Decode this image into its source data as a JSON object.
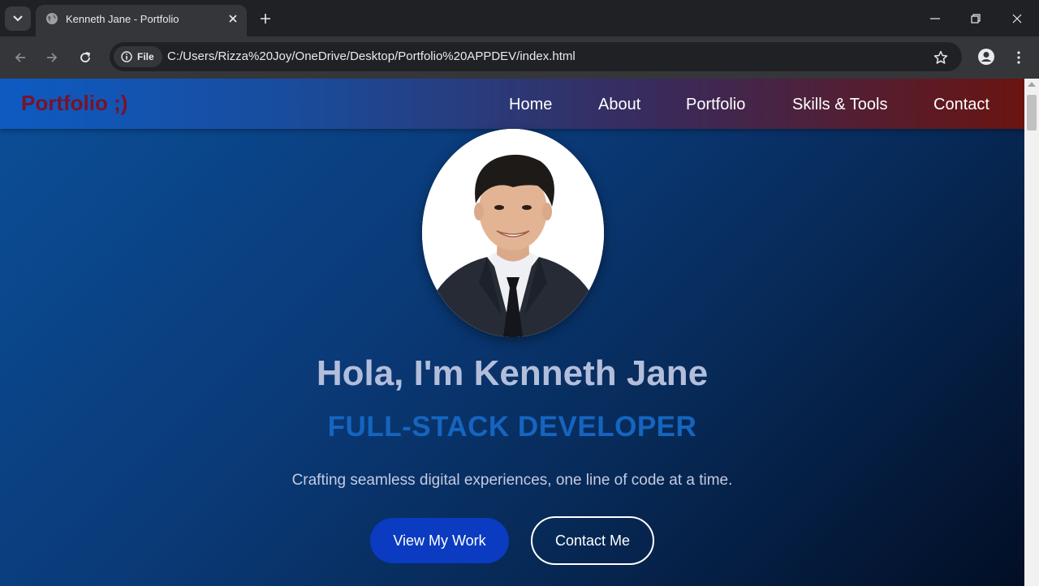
{
  "browser": {
    "tab_title": "Kenneth Jane - Portfolio",
    "chip_label": "File",
    "url": "C:/Users/Rizza%20Joy/OneDrive/Desktop/Portfolio%20APPDEV/index.html"
  },
  "site": {
    "brand": "Portfolio ;)",
    "nav": [
      "Home",
      "About",
      "Portfolio",
      "Skills & Tools",
      "Contact"
    ],
    "hero": {
      "title": "Hola, I'm Kenneth Jane",
      "role": "FULL-STACK DEVELOPER",
      "tagline": "Crafting seamless digital experiences, one line of code at a time.",
      "primary_button": "View My Work",
      "secondary_button": "Contact Me"
    }
  },
  "colors": {
    "brand_text": "#7a1228",
    "role_text": "#1565c0",
    "primary_button": "#0b3bc0",
    "title_text": "#b3bedb"
  },
  "icons": [
    "tab-list-icon",
    "globe-icon",
    "close-icon",
    "plus-icon",
    "minimize-icon",
    "restore-icon",
    "back-arrow-icon",
    "forward-arrow-icon",
    "reload-icon",
    "info-icon",
    "star-icon",
    "profile-icon",
    "more-vert-icon"
  ]
}
